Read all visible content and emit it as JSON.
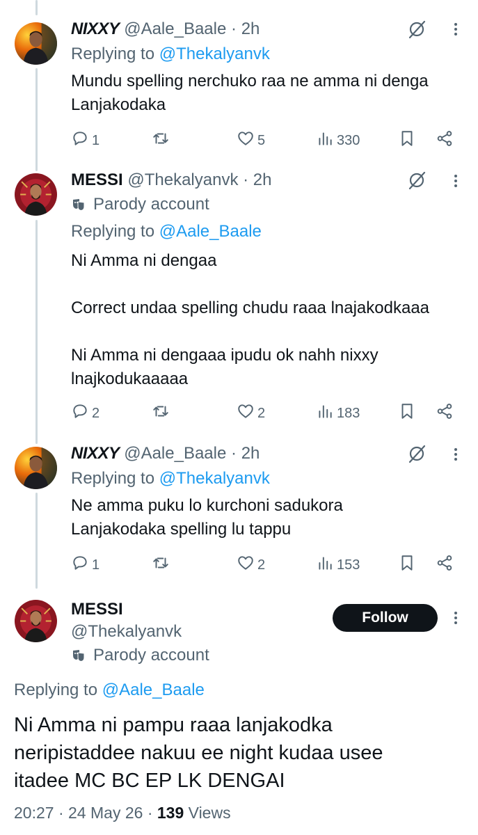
{
  "tweets": [
    {
      "name": "NIXXY",
      "handle": "@Aale_Baale",
      "time": "2h",
      "dot": "·",
      "replying_prefix": "Replying to ",
      "replying_to": "@Thekalyanvk",
      "text": "Mundu spelling nerchuko raa ne amma ni denga\nLanjakodaka",
      "replies": "1",
      "reposts": "",
      "likes": "5",
      "views": "330"
    },
    {
      "name": "MESSI",
      "handle": "@Thekalyanvk",
      "time": "2h",
      "dot": "·",
      "parody_label": "Parody account",
      "replying_prefix": "Replying to ",
      "replying_to": "@Aale_Baale",
      "text": "Ni Amma ni dengaa\n\nCorrect undaa spelling chudu raaa lnajakodkaaa\n\nNi Amma ni dengaaa ipudu ok nahh nixxy\nlnajkodukaaaaa",
      "replies": "2",
      "reposts": "",
      "likes": "2",
      "views": "183"
    },
    {
      "name": "NIXXY",
      "handle": "@Aale_Baale",
      "time": "2h",
      "dot": "·",
      "replying_prefix": "Replying to ",
      "replying_to": "@Thekalyanvk",
      "text": "Ne amma puku lo kurchoni sadukora\nLanjakodaka spelling lu tappu",
      "replies": "1",
      "reposts": "",
      "likes": "2",
      "views": "153"
    }
  ],
  "main_tweet": {
    "name": "MESSI",
    "handle": "@Thekalyanvk",
    "parody_label": "Parody account",
    "follow_label": "Follow",
    "replying_prefix": "Replying to ",
    "replying_to": "@Aale_Baale",
    "text": "Ni Amma ni pampu raaa lanjakodka\nneripistaddee nakuu ee night kudaa usee\nitadee MC BC EP LK DENGAI",
    "time": "20:27",
    "date": "24 May 26",
    "views_count": "139",
    "views_label": "Views",
    "dot": "·"
  },
  "icons": {
    "reply": "reply-icon",
    "repost": "repost-icon",
    "like": "heart-icon",
    "views": "views-icon",
    "bookmark": "bookmark-icon",
    "share": "share-icon",
    "grok": "grok-icon",
    "more": "more-icon",
    "parody": "parody-mask-icon"
  },
  "colors": {
    "link": "#1d9bf0",
    "secondary": "#536471",
    "primary": "#0f1419",
    "thread_line": "#cfd9de"
  }
}
